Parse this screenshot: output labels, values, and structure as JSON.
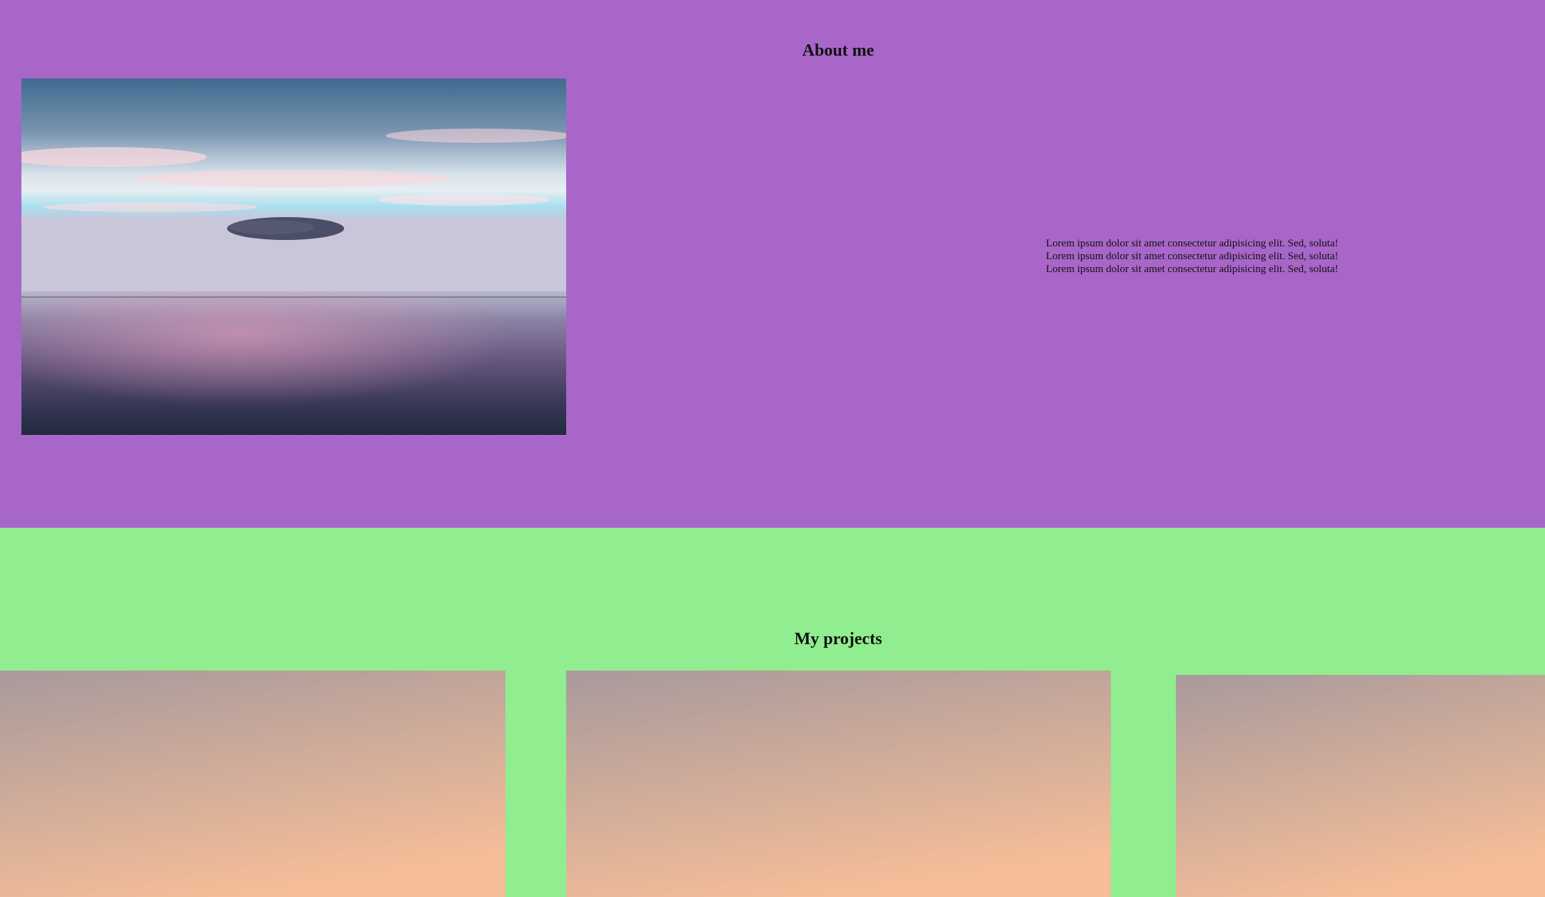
{
  "about": {
    "title": "About me",
    "paragraphs": [
      "Lorem ipsum dolor sit amet consectetur adipisicing elit. Sed, soluta!",
      "Lorem ipsum dolor sit amet consectetur adipisicing elit. Sed, soluta!",
      "Lorem ipsum dolor sit amet consectetur adipisicing elit. Sed, soluta!"
    ],
    "background": "#a866c9"
  },
  "projects": {
    "title": "My projects",
    "background": "#90ee90",
    "card_gradient": [
      "#a89a9c",
      "#f5bd98"
    ]
  }
}
